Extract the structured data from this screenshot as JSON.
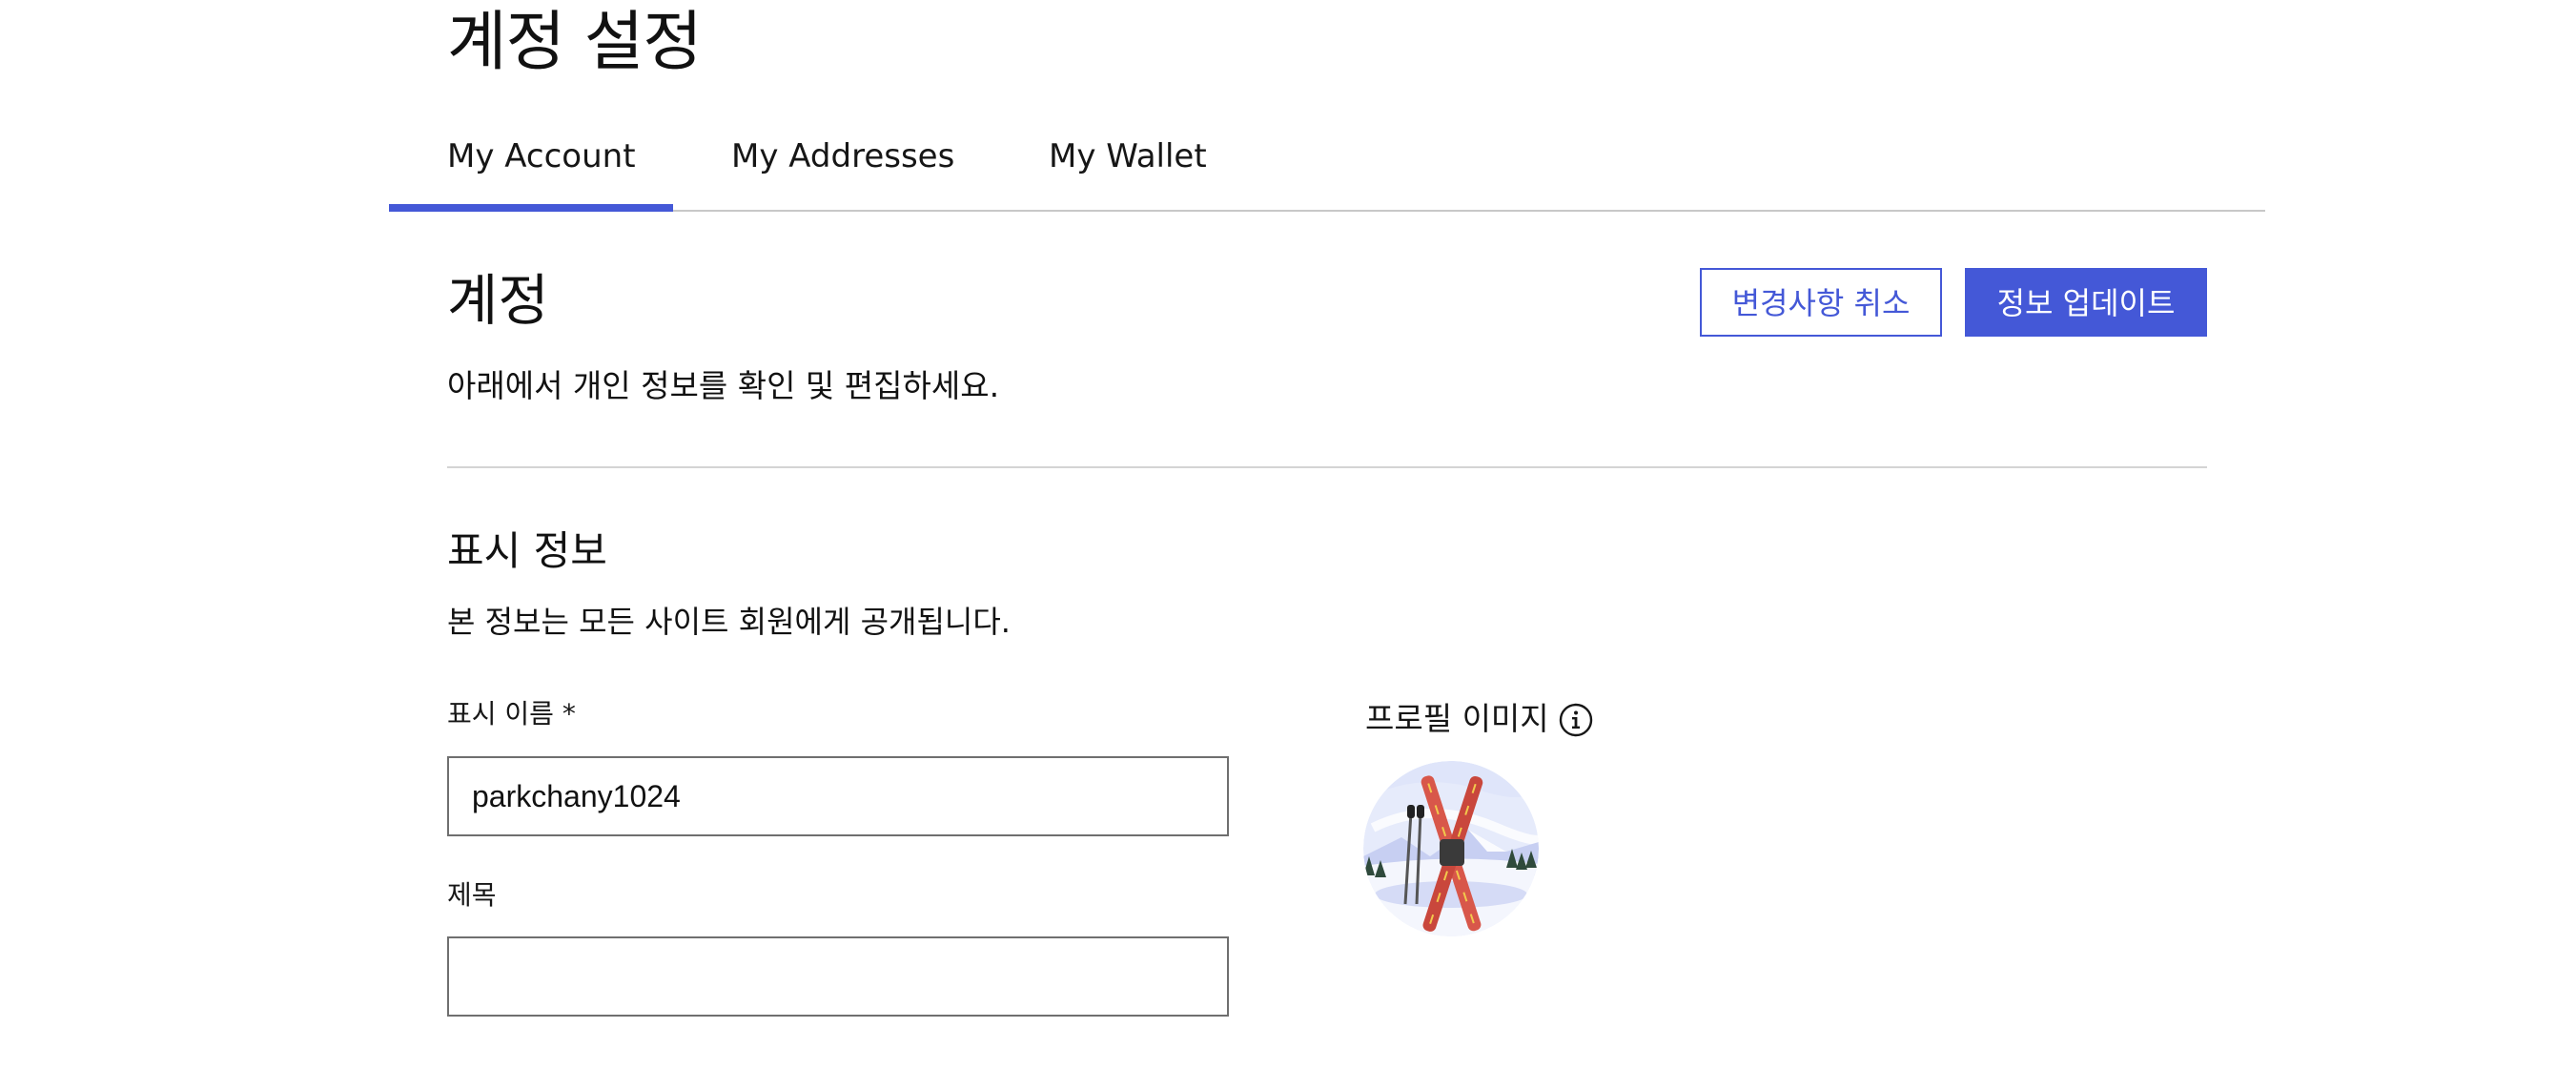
{
  "header": {
    "title": "계정 설정"
  },
  "tabs": [
    {
      "label": "My Account",
      "active": true
    },
    {
      "label": "My Addresses",
      "active": false
    },
    {
      "label": "My Wallet",
      "active": false
    }
  ],
  "account": {
    "heading": "계정",
    "description": "아래에서 개인 정보를 확인 및 편집하세요.",
    "cancel_label": "변경사항 취소",
    "update_label": "정보 업데이트"
  },
  "display_info": {
    "heading": "표시 정보",
    "description": "본 정보는 모든 사이트 회원에게 공개됩니다.",
    "name_label": "표시 이름 *",
    "name_value": "parkchany1024",
    "title_label": "제목",
    "title_value": "",
    "profile_image_label": "프로필 이미지"
  },
  "icons": {
    "info": "info-icon",
    "avatar": "skis-avatar-image"
  },
  "colors": {
    "accent": "#4458d7",
    "text": "#111111",
    "divider": "#d4d4d4",
    "input_border": "#6f6f6f"
  }
}
